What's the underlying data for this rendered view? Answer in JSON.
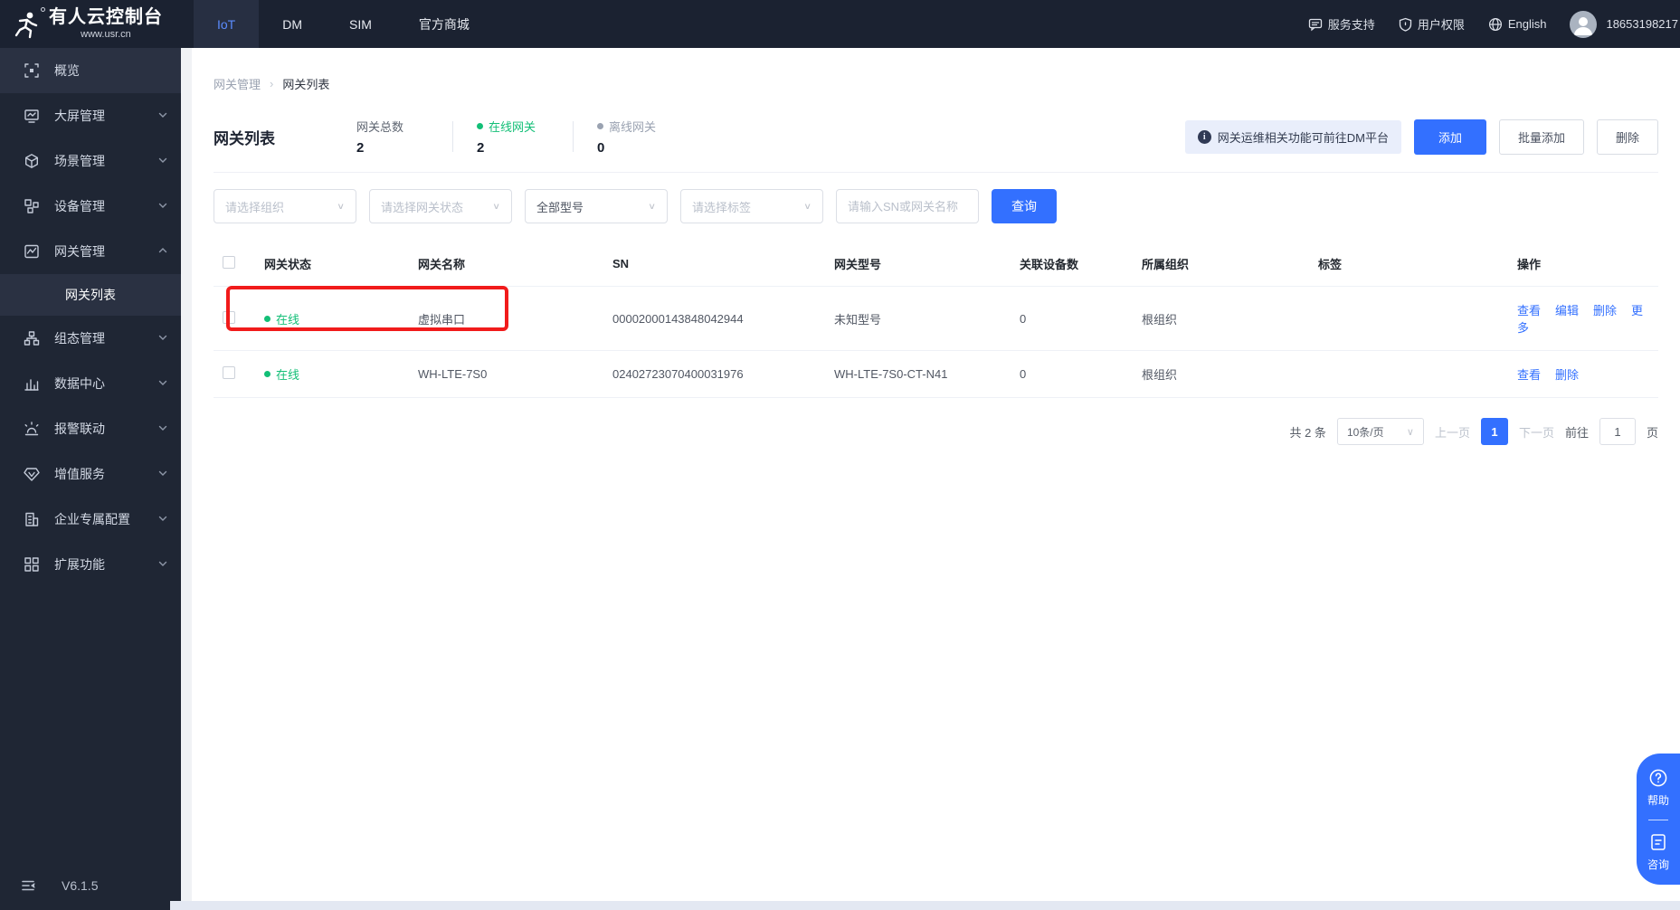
{
  "header": {
    "logo_title": "有人云控制台",
    "logo_subtitle": "www.usr.cn",
    "nav_tabs": [
      {
        "label": "IoT",
        "active": true
      },
      {
        "label": "DM",
        "active": false
      },
      {
        "label": "SIM",
        "active": false
      },
      {
        "label": "官方商城",
        "active": false
      }
    ],
    "support": "服务支持",
    "permissions": "用户权限",
    "language": "English",
    "account": "18653198217"
  },
  "sidebar": {
    "items": [
      {
        "label": "概览",
        "icon": "overview-icon",
        "chevron": "",
        "hl": true
      },
      {
        "label": "大屏管理",
        "icon": "screen-icon",
        "chevron": "down"
      },
      {
        "label": "场景管理",
        "icon": "scene-icon",
        "chevron": "down"
      },
      {
        "label": "设备管理",
        "icon": "device-icon",
        "chevron": "down"
      },
      {
        "label": "网关管理",
        "icon": "gateway-icon",
        "chevron": "up"
      },
      {
        "label": "网关列表",
        "icon": "",
        "sub": true,
        "active": true
      },
      {
        "label": "组态管理",
        "icon": "config-icon",
        "chevron": "down"
      },
      {
        "label": "数据中心",
        "icon": "data-icon",
        "chevron": "down"
      },
      {
        "label": "报警联动",
        "icon": "alarm-icon",
        "chevron": "down"
      },
      {
        "label": "增值服务",
        "icon": "vas-icon",
        "chevron": "down"
      },
      {
        "label": "企业专属配置",
        "icon": "enterprise-icon",
        "chevron": "down"
      },
      {
        "label": "扩展功能",
        "icon": "extend-icon",
        "chevron": "down"
      }
    ],
    "version": "V6.1.5"
  },
  "breadcrumb": {
    "parent": "网关管理",
    "current": "网关列表"
  },
  "summary": {
    "page_title": "网关列表",
    "stats": [
      {
        "label": "网关总数",
        "value": "2",
        "tone": ""
      },
      {
        "label": "在线网关",
        "value": "2",
        "tone": "green"
      },
      {
        "label": "离线网关",
        "value": "0",
        "tone": "gray"
      }
    ]
  },
  "toolbar": {
    "notice": "网关运维相关功能可前往DM平台",
    "add_label": "添加",
    "batch_add_label": "批量添加",
    "delete_label": "删除"
  },
  "filters": {
    "org_placeholder": "请选择组织",
    "status_placeholder": "请选择网关状态",
    "model_value": "全部型号",
    "tag_placeholder": "请选择标签",
    "search_placeholder": "请输入SN或网关名称",
    "query_label": "查询"
  },
  "table": {
    "headers": [
      "网关状态",
      "网关名称",
      "SN",
      "网关型号",
      "关联设备数",
      "所属组织",
      "标签",
      "操作"
    ],
    "rows": [
      {
        "status": "在线",
        "name": "虚拟串口",
        "sn": "00002000143848042944",
        "model": "未知型号",
        "devices": "0",
        "org": "根组织",
        "tags": "",
        "actions": [
          "查看",
          "编辑",
          "删除",
          "更多"
        ]
      },
      {
        "status": "在线",
        "name": "WH-LTE-7S0",
        "sn": "02402723070400031976",
        "model": "WH-LTE-7S0-CT-N41",
        "devices": "0",
        "org": "根组织",
        "tags": "",
        "actions": [
          "查看",
          "删除"
        ]
      }
    ]
  },
  "pagination": {
    "total": "共 2 条",
    "page_size": "10条/页",
    "prev": "上一页",
    "page": "1",
    "next": "下一页",
    "goto_prefix": "前往",
    "goto_value": "1",
    "goto_suffix": "页"
  },
  "floating": {
    "help": "帮助",
    "consult": "咨询"
  },
  "colors": {
    "primary": "#3370ff",
    "success": "#13bf77",
    "annotation": "#f11b1b"
  }
}
